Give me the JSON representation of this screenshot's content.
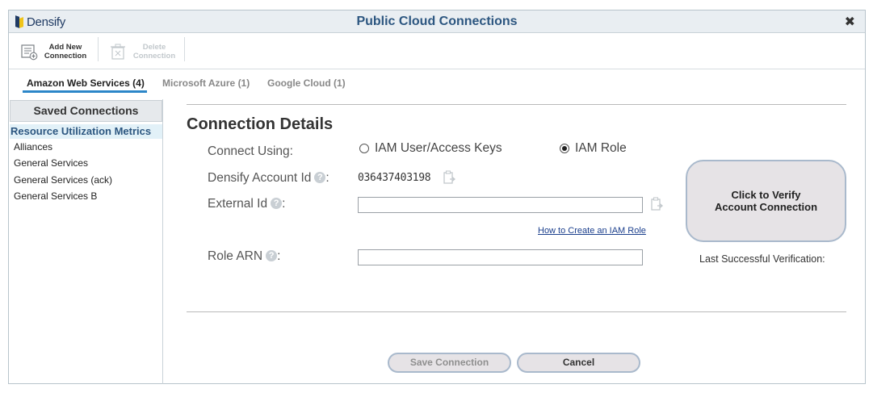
{
  "header": {
    "logo_text": "Densify",
    "title": "Public Cloud Connections",
    "close_glyph": "✖"
  },
  "toolbar": {
    "add_label_1": "Add New",
    "add_label_2": "Connection",
    "delete_label_1": "Delete",
    "delete_label_2": "Connection",
    "add_icon": "add-connection-icon",
    "delete_icon": "trash-icon"
  },
  "tabs": [
    {
      "label": "Amazon Web Services (4)",
      "active": true
    },
    {
      "label": "Microsoft Azure (1)",
      "active": false
    },
    {
      "label": "Google Cloud (1)",
      "active": false
    }
  ],
  "sidebar": {
    "title": "Saved Connections",
    "items": [
      {
        "label": "Resource Utilization Metrics",
        "selected": true
      },
      {
        "label": "Alliances"
      },
      {
        "label": "General Services"
      },
      {
        "label": "General Services (ack)"
      },
      {
        "label": "General Services B"
      }
    ]
  },
  "details": {
    "title": "Connection Details",
    "connect_using_label": "Connect Using:",
    "option_keys": "IAM User/Access Keys",
    "option_role": "IAM Role",
    "selected_option": "IAM Role",
    "account_id_label": "Densify Account Id",
    "account_id_value": "036437403198",
    "external_id_label": "External Id",
    "external_id_value": "",
    "how_to_link": "How to Create an IAM Role",
    "role_arn_label": "Role ARN",
    "role_arn_value": "",
    "colon": ":",
    "help_glyph": "?"
  },
  "verify": {
    "button_label": "Click to Verify\nAccount Connection",
    "last_label": "Last Successful Verification:"
  },
  "footer": {
    "save_label": "Save Connection",
    "cancel_label": "Cancel"
  },
  "colors": {
    "title_blue": "#2c5680",
    "tab_accent": "#2c86c8",
    "selected_bg": "#e2f1f8"
  }
}
